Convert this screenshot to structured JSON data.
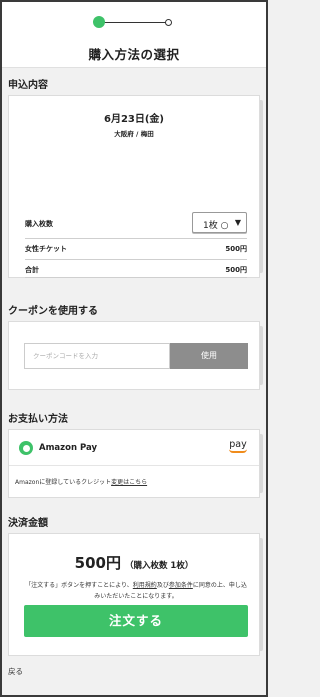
{
  "header": {
    "title": "購入方法の選択",
    "stepper": {
      "current_step": 1,
      "total_steps": 2
    }
  },
  "order": {
    "section_title": "申込内容",
    "date": "6月23日(金)",
    "venue": "大阪府 / 梅田",
    "quantity_label": "購入枚数",
    "quantity_value": "1枚",
    "ticket_label": "女性チケット",
    "ticket_price": "500円",
    "total_label": "合計",
    "total_price": "500円"
  },
  "coupon": {
    "section_title": "クーポンを使用する",
    "placeholder": "クーポンコードを入力",
    "apply_label": "使用"
  },
  "payment": {
    "section_title": "お支払い方法",
    "method_name": "Amazon Pay",
    "logo_text": "pay",
    "note_prefix": "Amazonに登録しているクレジット",
    "note_link": "変更はこちら"
  },
  "settlement": {
    "section_title": "決済金額",
    "amount": "500円",
    "amount_detail": "（購入枚数 1枚）",
    "terms_part1": "「注文する」ボタンを押すことにより、",
    "terms_link1": "利用規約",
    "terms_and": "及び",
    "terms_link2": "参加条件",
    "terms_part2": "に同意の上、申し込みいただいたことになります。",
    "order_button": "注文する"
  },
  "footer": {
    "back_label": "戻る"
  },
  "colors": {
    "accent_green": "#3ec269",
    "button_gray": "#8d8d8d",
    "amazon_orange": "#f08c1c"
  }
}
